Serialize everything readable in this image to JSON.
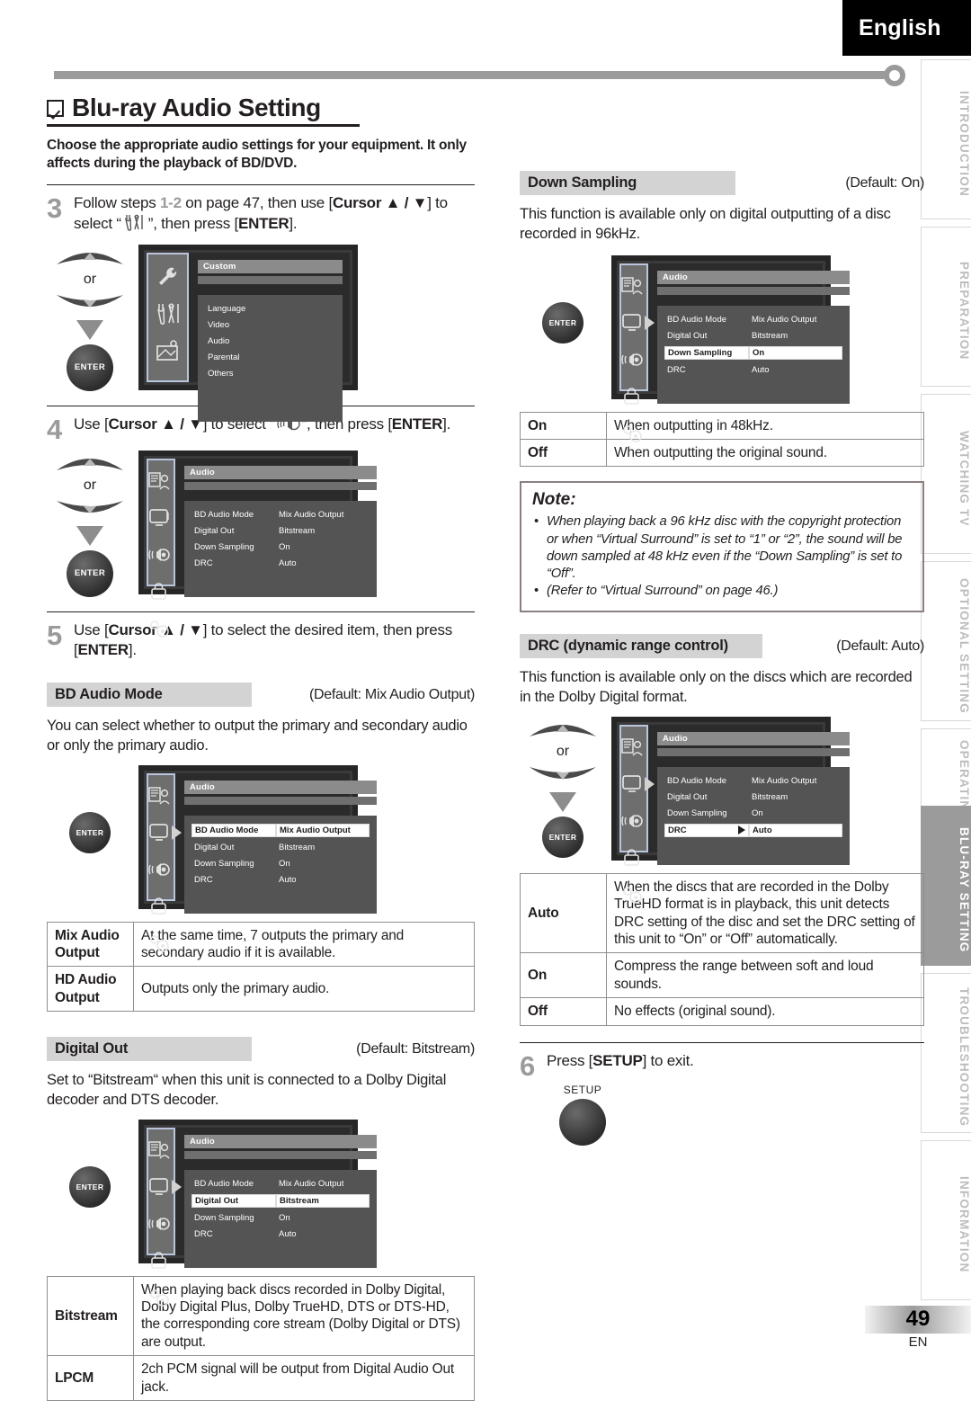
{
  "header": {
    "language_tab": "English"
  },
  "side_tabs": [
    {
      "label": "INTRODUCTION",
      "active": false
    },
    {
      "label": "PREPARATION",
      "active": false
    },
    {
      "label": "WATCHING TV",
      "active": false
    },
    {
      "label": "OPTIONAL SETTING",
      "active": false
    },
    {
      "label": "OPERATING BLU-RAY",
      "active": false
    },
    {
      "label": "BLU-RAY SETTING",
      "active": true
    },
    {
      "label": "TROUBLESHOOTING",
      "active": false
    },
    {
      "label": "INFORMATION",
      "active": false
    }
  ],
  "section": {
    "title": "Blu-ray Audio Setting",
    "lead": "Choose the appropriate audio settings for your equipment. It only affects during the playback of BD/DVD."
  },
  "steps": {
    "step3": {
      "number": "3",
      "text_a": "Follow steps ",
      "pages": "1-2",
      "text_b": " on page 47, then use [",
      "cursor": "Cursor ▲ / ▼",
      "text_c": "] to select “",
      "text_d": "”, then press [",
      "enter": "ENTER",
      "text_e": "]."
    },
    "step4": {
      "number": "4",
      "text_a": "Use [",
      "cursor": "Cursor ▲ / ▼",
      "text_b": "] to select “",
      "text_c": "”, then press [",
      "enter": "ENTER",
      "text_d": "]."
    },
    "step5": {
      "number": "5",
      "text_a": "Use [",
      "cursor": "Cursor ▲ / ▼",
      "text_b": "] to select the desired item, then press [",
      "enter": "ENTER",
      "text_c": "]."
    },
    "step6": {
      "number": "6",
      "text_a": "Press [",
      "setup": "SETUP",
      "text_b": "] to exit.",
      "button_label": "SETUP"
    }
  },
  "remote": {
    "or_label": "or",
    "enter_label": "ENTER"
  },
  "osd_custom": {
    "title": "Custom",
    "items": [
      "Language",
      "Video",
      "Audio",
      "Parental",
      "Others"
    ]
  },
  "osd_audio": {
    "title": "Audio",
    "rows": [
      {
        "key": "BD Audio Mode",
        "value": "Mix Audio Output"
      },
      {
        "key": "Digital Out",
        "value": "Bitstream"
      },
      {
        "key": "Down Sampling",
        "value": "On"
      },
      {
        "key": "DRC",
        "value": "Auto"
      }
    ]
  },
  "settings": {
    "bd_audio_mode": {
      "name": "BD Audio Mode",
      "default": "(Default: Mix Audio Output)",
      "description": "You can select whether to output the primary and secondary audio or only the primary audio.",
      "options": [
        {
          "key": "Mix Audio\nOutput",
          "desc": "At the same time, 7 outputs the primary and secondary audio if it is available."
        },
        {
          "key": "HD Audio\nOutput",
          "desc": "Outputs only the primary audio."
        }
      ]
    },
    "digital_out": {
      "name": "Digital Out",
      "default": "(Default: Bitstream)",
      "description": "Set to “Bitstream“ when this unit is connected to a Dolby Digital decoder and DTS decoder.",
      "options": [
        {
          "key": "Bitstream",
          "desc": "When playing back discs recorded in Dolby Digital, Dolby Digital Plus, Dolby TrueHD, DTS or DTS-HD, the corresponding core stream (Dolby Digital or DTS) are output."
        },
        {
          "key": "LPCM",
          "desc": "2ch PCM signal will be output from Digital Audio Out jack."
        }
      ]
    },
    "down_sampling": {
      "name": "Down Sampling",
      "default": "(Default: On)",
      "description": "This function is available only on digital outputting of a disc recorded in 96kHz.",
      "options": [
        {
          "key": "On",
          "desc": "When outputting in 48kHz."
        },
        {
          "key": "Off",
          "desc": "When outputting the original sound."
        }
      ]
    },
    "drc": {
      "name": "DRC (dynamic range control)",
      "default": "(Default: Auto)",
      "description": "This function is available only on the discs which are recorded in the Dolby Digital format.",
      "options": [
        {
          "key": "Auto",
          "desc": "When the discs that are recorded in the Dolby TrueHD format is in playback, this unit detects DRC setting of the disc and set the DRC setting of this unit to “On” or “Off” automatically."
        },
        {
          "key": "On",
          "desc": "Compress the range between soft and loud sounds."
        },
        {
          "key": "Off",
          "desc": "No effects (original sound)."
        }
      ]
    }
  },
  "note": {
    "title": "Note:",
    "items": [
      "When playing back a 96 kHz disc with the copyright protection or when “Virtual Surround” is set to “1” or “2”, the sound will be down sampled at 48 kHz even if the “Down Sampling” is set to “Off”.",
      "(Refer to “Virtual Surround” on page 46.)"
    ]
  },
  "footer": {
    "page_number": "49",
    "region": "EN"
  },
  "colors": {
    "accent_gray": "#9b9b9b",
    "band_gray": "#d3d3d3",
    "osd_bg": "#2b2b2b"
  }
}
